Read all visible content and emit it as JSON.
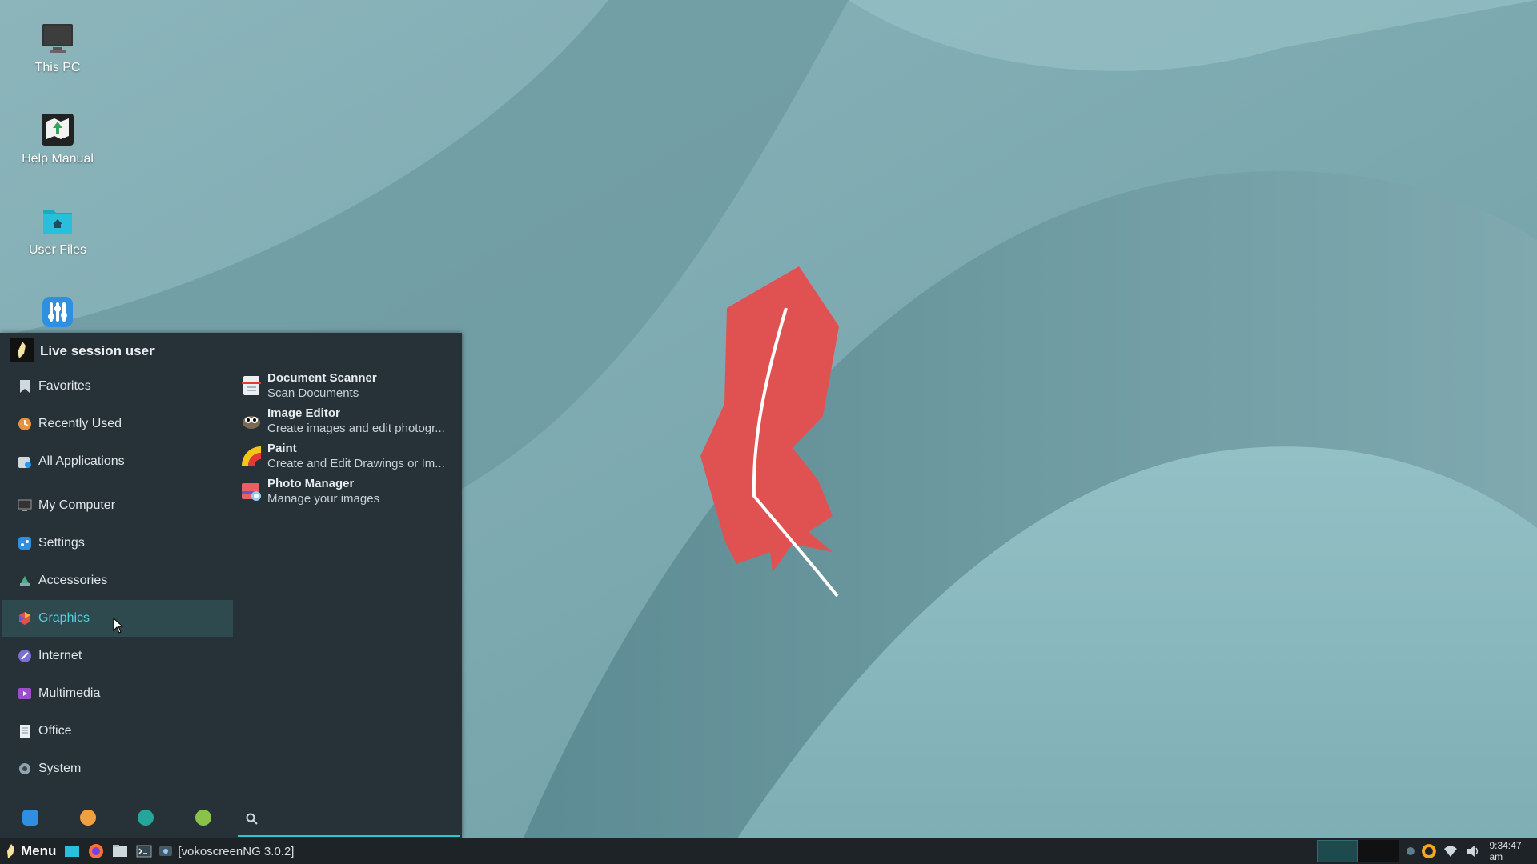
{
  "colors": {
    "accent": "#4fd0dc",
    "menu_bg": "#263238",
    "taskbar_bg": "#1d2326",
    "feather": "#e05252"
  },
  "desktop": {
    "icons": [
      {
        "label": "This PC",
        "icon": "monitor-icon"
      },
      {
        "label": "Help Manual",
        "icon": "help-manual-icon"
      },
      {
        "label": "User Files",
        "icon": "home-folder-icon"
      },
      {
        "label": "",
        "icon": "settings-app-icon"
      }
    ]
  },
  "menu": {
    "user": "Live session user",
    "categories": [
      {
        "label": "Favorites",
        "icon": "bookmark-icon"
      },
      {
        "label": "Recently Used",
        "icon": "recent-icon"
      },
      {
        "label": "All Applications",
        "icon": "all-apps-icon"
      },
      {
        "label": "My Computer",
        "icon": "computer-icon"
      },
      {
        "label": "Settings",
        "icon": "settings-icon"
      },
      {
        "label": "Accessories",
        "icon": "accessories-icon"
      },
      {
        "label": "Graphics",
        "icon": "graphics-icon",
        "selected": true
      },
      {
        "label": "Internet",
        "icon": "internet-icon"
      },
      {
        "label": "Multimedia",
        "icon": "multimedia-icon"
      },
      {
        "label": "Office",
        "icon": "office-icon"
      },
      {
        "label": "System",
        "icon": "system-icon"
      }
    ],
    "apps": [
      {
        "name": "Document Scanner",
        "desc": "Scan Documents",
        "icon": "scanner-icon"
      },
      {
        "name": "Image Editor",
        "desc": "Create images and edit photogr...",
        "icon": "gimp-icon"
      },
      {
        "name": "Paint",
        "desc": "Create and Edit Drawings or Im...",
        "icon": "paint-icon"
      },
      {
        "name": "Photo Manager",
        "desc": "Manage your images",
        "icon": "photo-manager-icon"
      }
    ],
    "bottom": [
      "settings-icon",
      "lock-icon",
      "user-icon",
      "logout-icon",
      "search-icon"
    ]
  },
  "taskbar": {
    "menu_label": "Menu",
    "task_label": "[vokoscreenNG 3.0.2]",
    "clock": "9:34:47 am"
  }
}
